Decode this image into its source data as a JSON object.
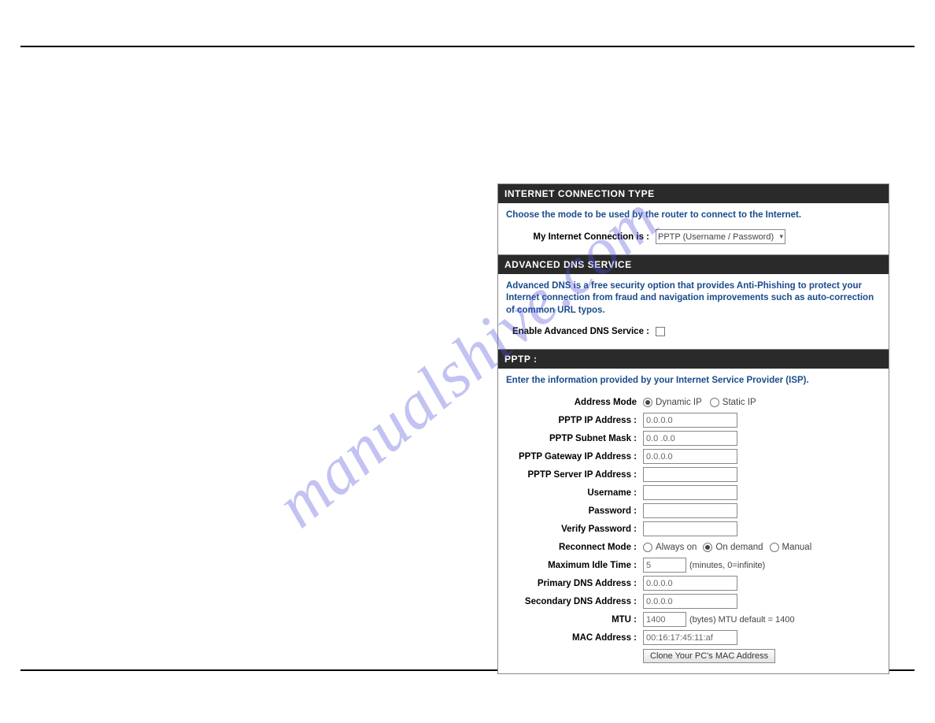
{
  "watermark": "manualshive.com",
  "sections": {
    "connectionType": {
      "header": "INTERNET CONNECTION TYPE",
      "desc": "Choose the mode to be used by the router to connect to the Internet.",
      "connLabel": "My Internet Connection is :",
      "connValue": "PPTP (Username / Password)"
    },
    "advancedDns": {
      "header": "ADVANCED DNS SERVICE",
      "desc": "Advanced DNS is a free security option that provides Anti-Phishing to protect your Internet connection from fraud and navigation improvements such as auto-correction of common URL typos.",
      "enableLabel": "Enable Advanced DNS Service :"
    },
    "pptp": {
      "header": "PPTP :",
      "desc": "Enter the information provided by your Internet Service Provider (ISP).",
      "labels": {
        "addressMode": "Address Mode",
        "pptpIp": "PPTP IP Address :",
        "pptpSubnet": "PPTP Subnet Mask :",
        "pptpGateway": "PPTP Gateway IP Address :",
        "pptpServer": "PPTP Server IP Address :",
        "username": "Username :",
        "password": "Password :",
        "verifyPassword": "Verify Password :",
        "reconnectMode": "Reconnect Mode :",
        "maxIdle": "Maximum Idle Time :",
        "primaryDns": "Primary DNS Address :",
        "secondaryDns": "Secondary DNS Address :",
        "mtu": "MTU :",
        "macAddress": "MAC Address :"
      },
      "options": {
        "dynamicIp": "Dynamic IP",
        "staticIp": "Static IP",
        "alwaysOn": "Always on",
        "onDemand": "On demand",
        "manual": "Manual"
      },
      "values": {
        "ipZero": "0.0.0.0",
        "subnetZero": "0.0 .0.0",
        "maxIdle": "5",
        "mtu": "1400",
        "mac": "00:16:17:45:11:af"
      },
      "hints": {
        "idleHint": "(minutes, 0=infinite)",
        "mtuHint": "(bytes) MTU default = 1400"
      },
      "buttons": {
        "cloneMac": "Clone Your PC's MAC Address"
      }
    }
  }
}
